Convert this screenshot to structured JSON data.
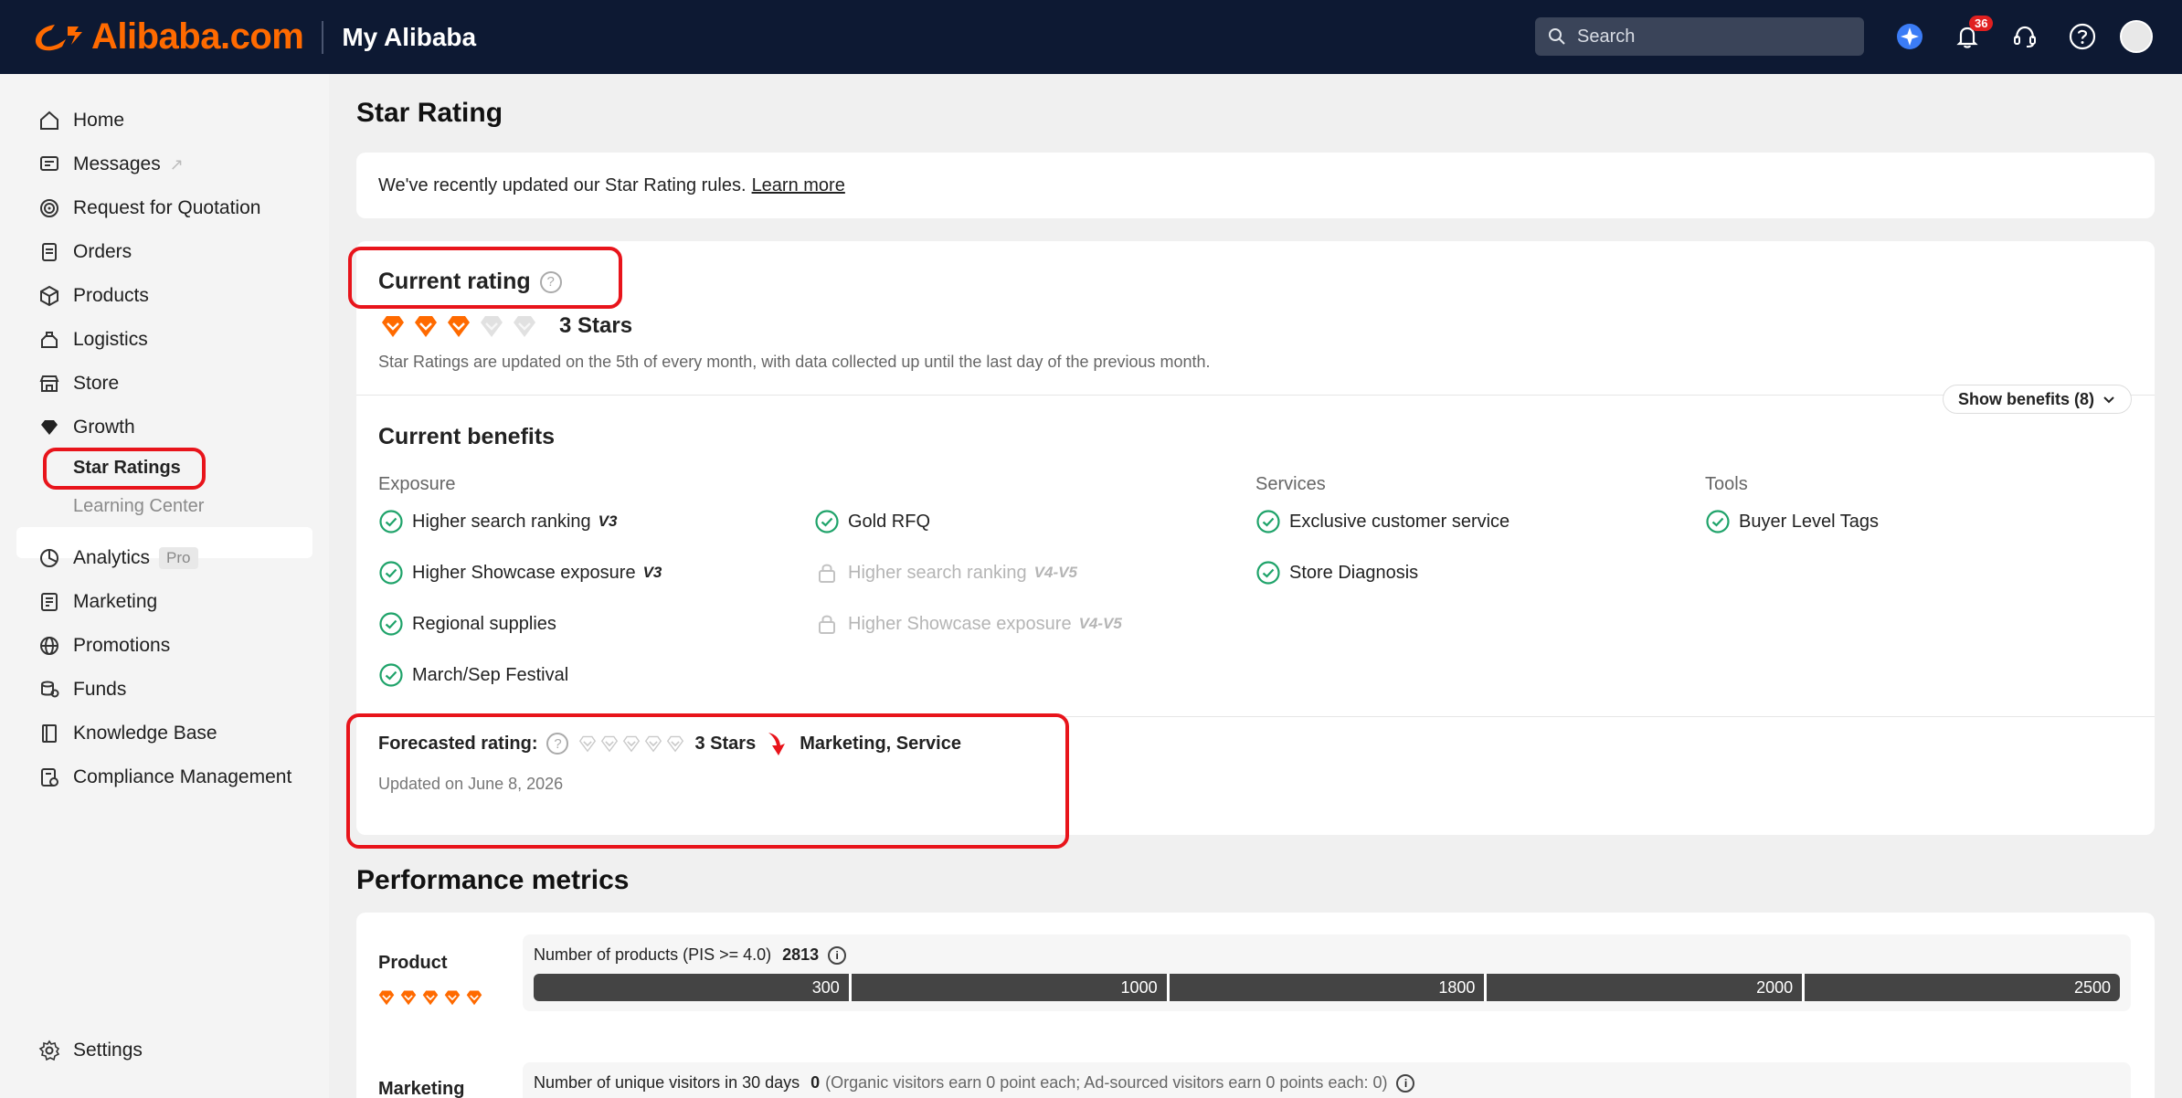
{
  "header": {
    "logo_text": "Alibaba.com",
    "section_title": "My Alibaba",
    "search_placeholder": "Search",
    "notification_count": "36",
    "brand_color": "#ff6a00",
    "bg_color": "#0d1933"
  },
  "sidebar": {
    "items": [
      {
        "label": "Home",
        "icon": "home-icon"
      },
      {
        "label": "Messages",
        "icon": "message-icon"
      },
      {
        "label": "Request for Quotation",
        "icon": "rfq-icon"
      },
      {
        "label": "Orders",
        "icon": "orders-icon"
      },
      {
        "label": "Products",
        "icon": "box-icon"
      },
      {
        "label": "Logistics",
        "icon": "logistics-icon"
      },
      {
        "label": "Store",
        "icon": "store-icon"
      },
      {
        "label": "Growth",
        "icon": "diamond-icon"
      },
      {
        "label": "Analytics",
        "icon": "analytics-icon"
      },
      {
        "label": "Marketing",
        "icon": "marketing-icon"
      },
      {
        "label": "Promotions",
        "icon": "globe-icon"
      },
      {
        "label": "Funds",
        "icon": "funds-icon"
      },
      {
        "label": "Knowledge Base",
        "icon": "book-icon"
      },
      {
        "label": "Compliance Management",
        "icon": "compliance-icon"
      }
    ],
    "growth_sub": {
      "active": "Star Ratings",
      "other": "Learning Center"
    },
    "pro_tag": "Pro",
    "settings": "Settings"
  },
  "main": {
    "title": "Star Rating",
    "notice_text": "We've recently updated our Star Rating rules.",
    "notice_link": "Learn more",
    "current_rating_title": "Current rating",
    "current_stars": 3,
    "max_stars": 5,
    "current_stars_label": "3 Stars",
    "update_note": "Star Ratings are updated on the 5th of every month, with data collected up until the last day of the previous month.",
    "show_benefits": "Show benefits (8)",
    "current_benefits_title": "Current benefits",
    "columns": {
      "exposure": "Exposure",
      "services": "Services",
      "tools": "Tools"
    },
    "benefits": {
      "exposure_a": [
        {
          "label": "Higher search ranking",
          "tag": "V3"
        },
        {
          "label": "Higher Showcase exposure",
          "tag": "V3"
        },
        {
          "label": "Regional supplies",
          "tag": ""
        },
        {
          "label": "March/Sep Festival",
          "tag": ""
        }
      ],
      "exposure_b": [
        {
          "label": "Gold RFQ",
          "tag": ""
        },
        {
          "label": "Higher search ranking",
          "tag": "V4-V5"
        },
        {
          "label": "Higher Showcase exposure",
          "tag": "V4-V5"
        }
      ],
      "services": [
        {
          "label": "Exclusive customer service"
        },
        {
          "label": "Store Diagnosis"
        }
      ],
      "tools": [
        {
          "label": "Buyer Level Tags"
        }
      ]
    },
    "forecast_label": "Forecasted rating:",
    "forecast_stars_label": "3 Stars",
    "forecast_areas": "Marketing, Service",
    "updated_on": "Updated on June 8, 2026",
    "perf_title": "Performance metrics",
    "metrics": [
      {
        "name": "Product",
        "label": "Number of products (PIS >= 4.0)",
        "value": "2813",
        "thresholds": [
          "300",
          "1000",
          "1800",
          "2000",
          "2500"
        ],
        "stars": 5
      },
      {
        "name": "Marketing",
        "label": "Number of unique visitors in 30 days",
        "value": "0",
        "detail": "(Organic visitors earn 0 point each; Ad-sourced visitors earn 0 points each: 0)"
      }
    ]
  }
}
